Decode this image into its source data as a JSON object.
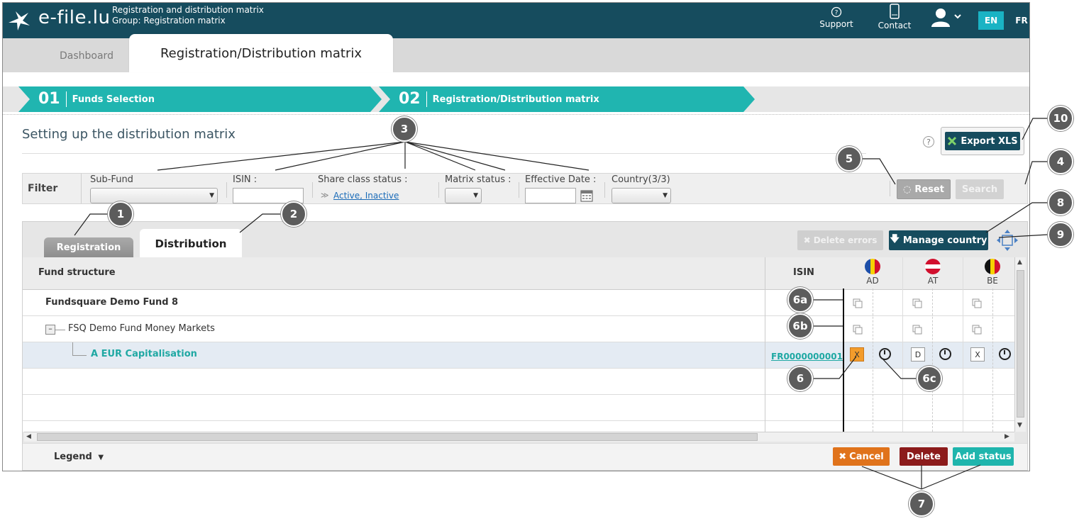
{
  "header": {
    "logo": "e-file.lu",
    "app_title_line1": "Registration and distribution matrix",
    "app_title_line2": "Group: Registration matrix",
    "support": "Support",
    "contact": "Contact",
    "lang_en": "EN",
    "lang_fr": "FR"
  },
  "tabs": {
    "dashboard": "Dashboard",
    "active": "Registration/Distribution matrix"
  },
  "wizard": {
    "step1_num": "01",
    "step1_label": "Funds Selection",
    "step2_num": "02",
    "step2_label": "Registration/Distribution matrix"
  },
  "section": {
    "title": "Setting up the distribution matrix",
    "help": "?",
    "export_label": "Export XLS"
  },
  "filter": {
    "label": "Filter",
    "subfund_label": "Sub-Fund",
    "isin_label": "ISIN :",
    "share_status_label": "Share class status :",
    "share_status_value": "Active, Inactive",
    "matrix_status_label": "Matrix status :",
    "effective_date_label": "Effective Date :",
    "country_label": "Country(3/3)",
    "reset_label": "Reset",
    "search_label": "Search"
  },
  "matrix": {
    "tab_registration": "Registration",
    "tab_distribution": "Distribution",
    "delete_errors_label": "Delete errors",
    "manage_country_label": "Manage country",
    "col_fund": "Fund structure",
    "col_isin": "ISIN",
    "countries": [
      "AD",
      "AT",
      "BE"
    ],
    "rows": [
      {
        "name": "Fundsquare Demo Fund 8"
      },
      {
        "name": "FSQ Demo Fund Money Markets"
      },
      {
        "name": "A EUR Capitalisation",
        "isin": "FR0000000001",
        "statuses": [
          "X",
          "D",
          "X"
        ]
      }
    ],
    "legend_label": "Legend",
    "cancel_label": "Cancel",
    "delete_label": "Delete",
    "add_status_label": "Add status"
  },
  "callouts": [
    "1",
    "2",
    "3",
    "4",
    "5",
    "6",
    "6a",
    "6b",
    "6c",
    "7",
    "8",
    "9",
    "10"
  ],
  "colors": {
    "header": "#164c5e",
    "teal": "#20b5b0",
    "orange": "#e0731b",
    "dark_red": "#8c1b1b"
  }
}
